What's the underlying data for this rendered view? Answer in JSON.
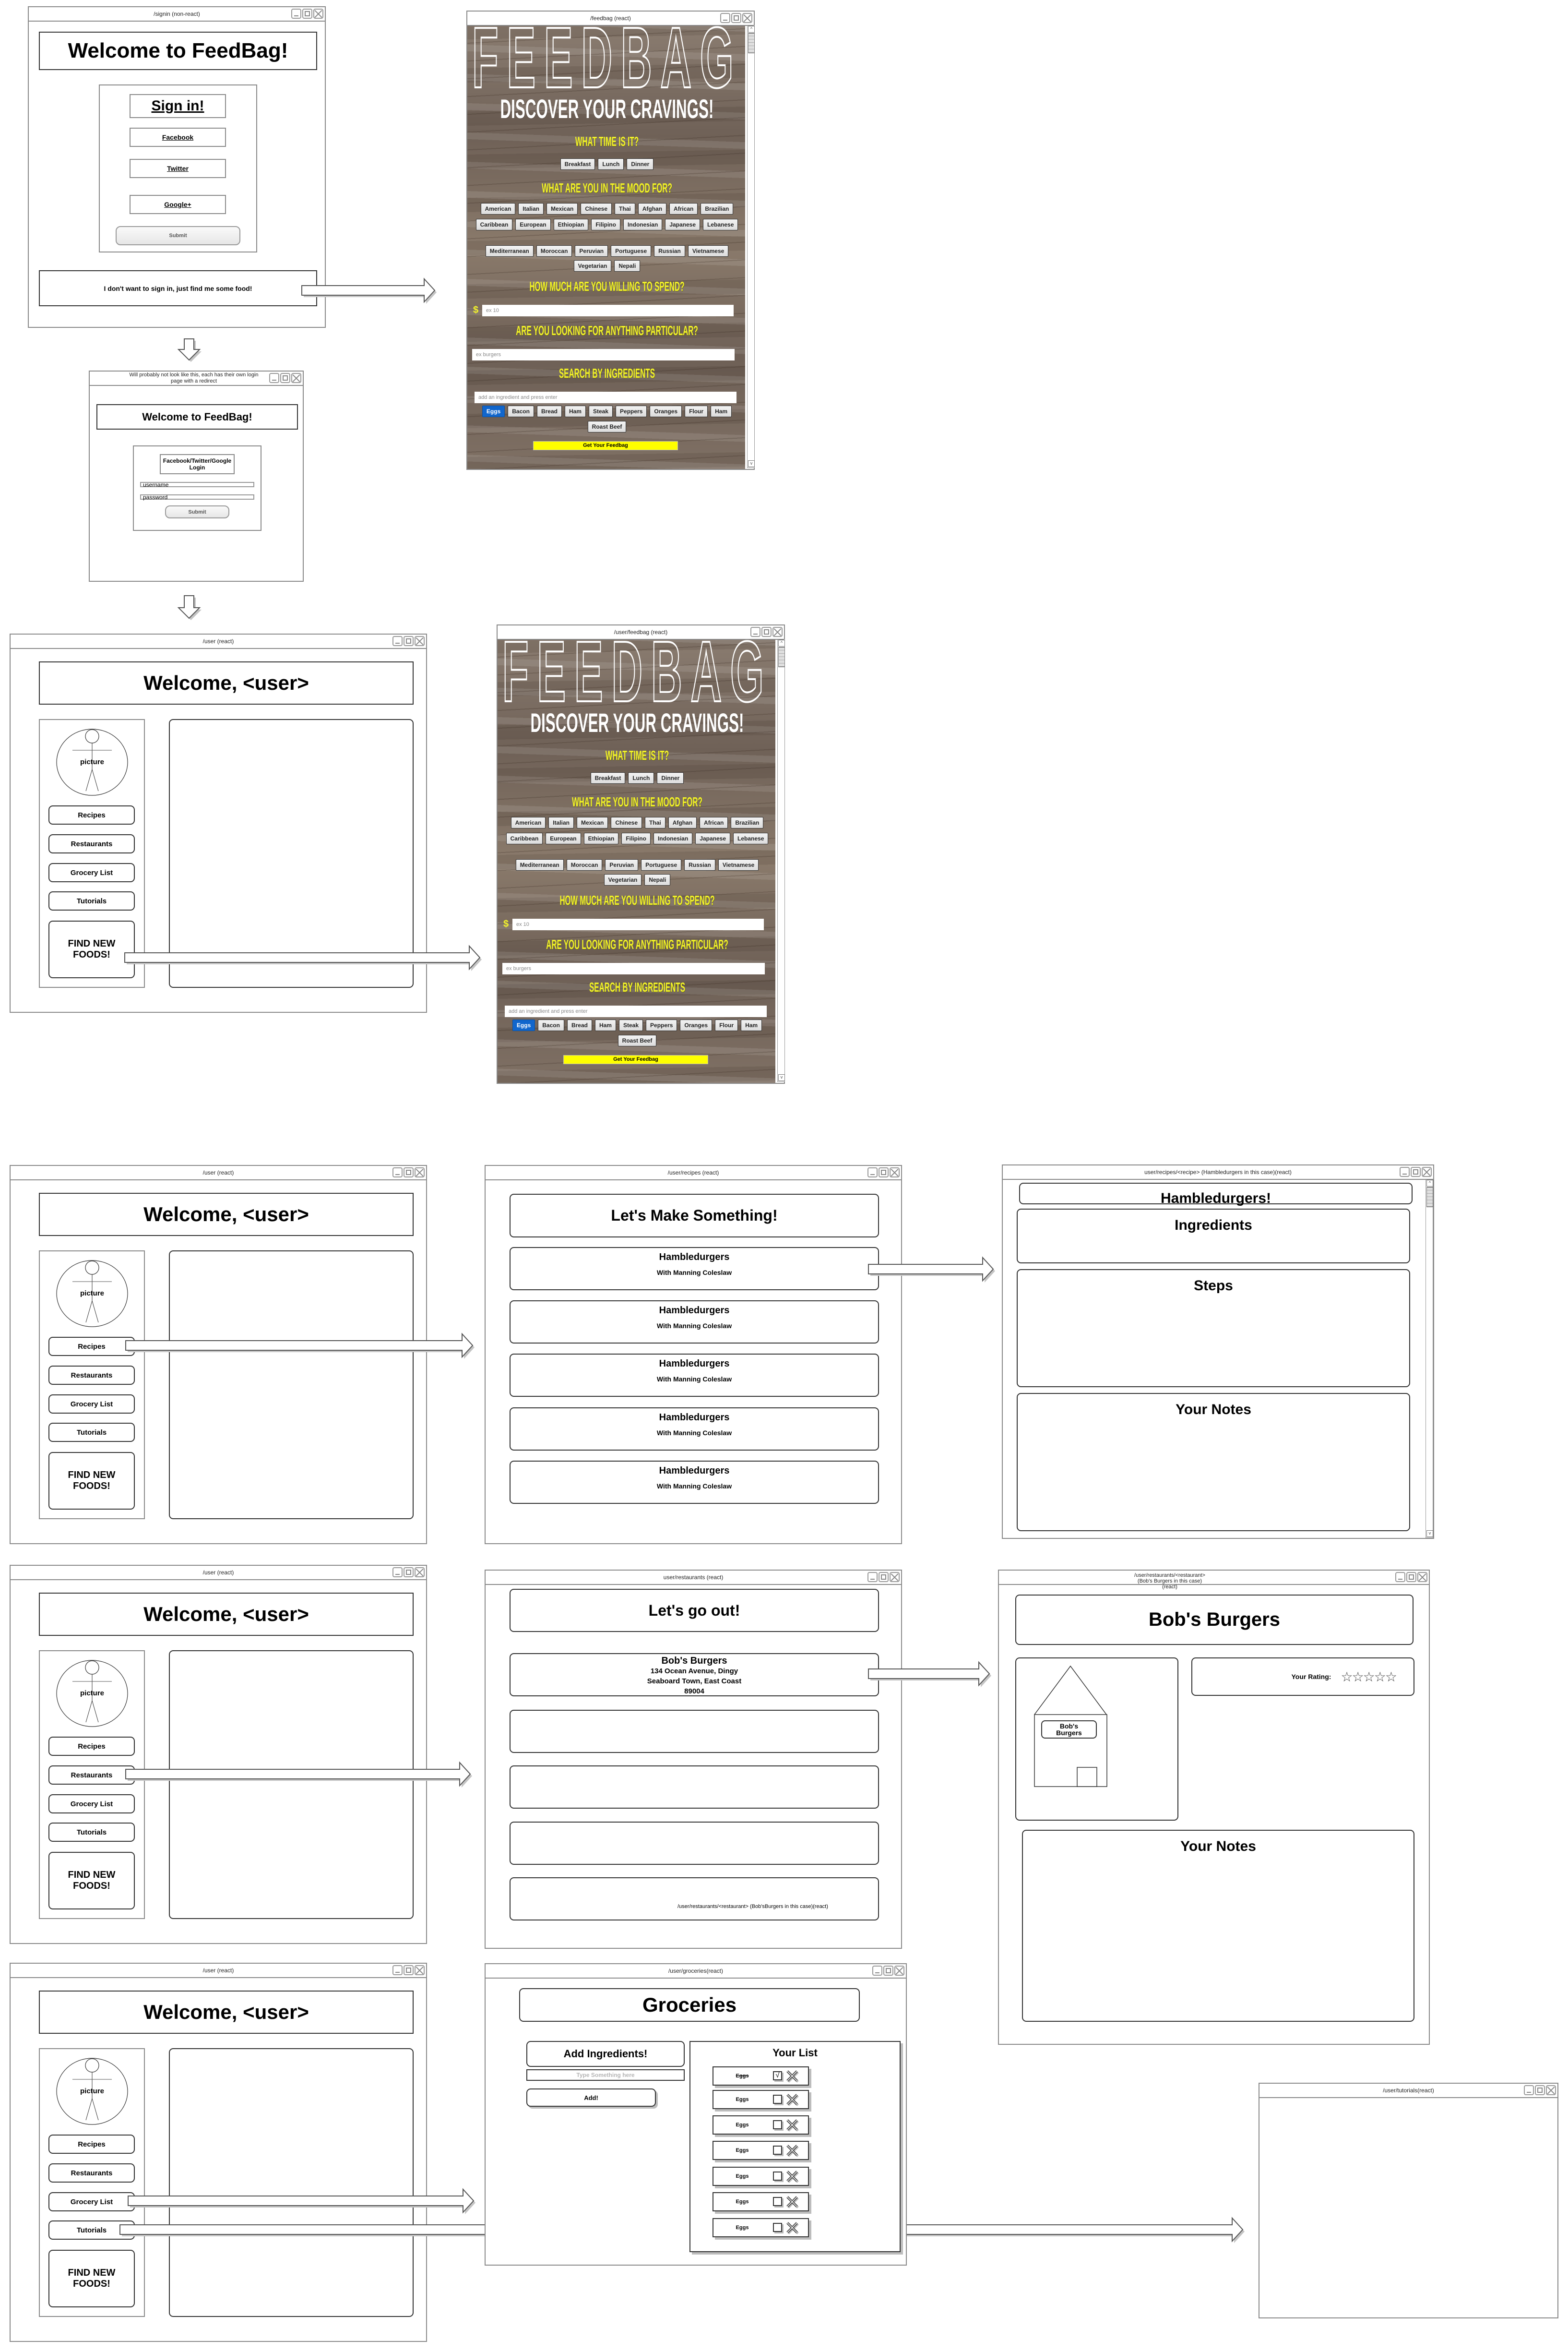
{
  "signin": {
    "title": "/signin (non-react)",
    "heading": "Welcome to FeedBag!",
    "sign_in": "Sign in!",
    "providers": [
      "Facebook",
      "Twitter",
      "Google+"
    ],
    "submit": "Submit",
    "guest": "I don't want to sign in, just find me some food!"
  },
  "redirect": {
    "title": "Will probably not look like this, each has their own login page with a redirect",
    "heading": "Welcome to FeedBag!",
    "login": "Facebook/Twitter/Google Login",
    "username": "username",
    "password": "password",
    "submit": "Submit"
  },
  "feedbag": {
    "titles": [
      "/feedbag (react)",
      "/user/feedbag (react)"
    ],
    "logo": "FEEDBAG",
    "tagline": "DISCOVER YOUR CRAVINGS!",
    "time_question": "WHAT TIME IS IT?",
    "times": [
      "Breakfast",
      "Lunch",
      "Dinner"
    ],
    "mood_question": "WHAT ARE YOU IN THE MOOD FOR?",
    "cuisines": [
      [
        "American",
        "Italian",
        "Mexican",
        "Chinese",
        "Thai",
        "Afghan",
        "African",
        "Brazilian"
      ],
      [
        "Caribbean",
        "European",
        "Ethiopian",
        "Filipino",
        "Indonesian",
        "Japanese",
        "Lebanese"
      ],
      [
        "Mediterranean",
        "Moroccan",
        "Peruvian",
        "Portuguese",
        "Russian",
        "Vietnamese"
      ],
      [
        "Vegetarian",
        "Nepali"
      ]
    ],
    "spend_question": "HOW MUCH ARE YOU WILLING TO SPEND?",
    "currency": "$",
    "spend_placeholder": "ex 10",
    "particular_question": "ARE YOU LOOKING FOR ANYTHING PARTICULAR?",
    "particular_placeholder": "ex burgers",
    "ingredients_question": "SEARCH BY INGREDIENTS",
    "ingredient_placeholder": "add an ingredient and press enter",
    "ingredients": [
      [
        {
          "label": "Eggs",
          "selected": true
        },
        {
          "label": "Bacon",
          "selected": false
        },
        {
          "label": "Bread",
          "selected": false
        },
        {
          "label": "Ham",
          "selected": false
        },
        {
          "label": "Steak",
          "selected": false
        },
        {
          "label": "Peppers",
          "selected": false
        },
        {
          "label": "Oranges",
          "selected": false
        },
        {
          "label": "Flour",
          "selected": false
        },
        {
          "label": "Ham",
          "selected": false
        }
      ],
      [
        {
          "label": "Roast Beef",
          "selected": false
        }
      ]
    ],
    "submit": "Get Your Feedbag",
    "colors": {
      "heading": "#f2f22a",
      "selected": "#1166cc",
      "submit": "#ffff00"
    }
  },
  "user": {
    "title": "/user (react)",
    "welcome": "Welcome, <user>",
    "picture": "picture",
    "nav": [
      "Recipes",
      "Restaurants",
      "Grocery List",
      "Tutorials"
    ],
    "find": "FIND NEW FOODS!"
  },
  "recipes": {
    "title": "/user/recipes (react)",
    "heading": "Let's Make Something!",
    "items": [
      {
        "name": "Hambledurgers",
        "subtitle": "With Manning Coleslaw"
      },
      {
        "name": "Hambledurgers",
        "subtitle": "With Manning Coleslaw"
      },
      {
        "name": "Hambledurgers",
        "subtitle": "With Manning Coleslaw"
      },
      {
        "name": "Hambledurgers",
        "subtitle": "With Manning Coleslaw"
      },
      {
        "name": "Hambledurgers",
        "subtitle": "With Manning Coleslaw"
      }
    ]
  },
  "recipe_detail": {
    "title": "user/recipes/<recipe> (Hambledurgers in this case)(react)",
    "heading": "Hambledurgers!",
    "sections": [
      "Ingredients",
      "Steps",
      "Your Notes"
    ]
  },
  "restaurants": {
    "title": "user/restaurants (react)",
    "heading": "Let's go out!",
    "items": [
      {
        "name": "Bob's Burgers",
        "address": [
          "134 Ocean Avenue, Dingy",
          "Seaboard Town, East Coast",
          "89004"
        ]
      }
    ],
    "note": "/user/restaurants/<restaurant> (Bob'sBurgers in this case)(react)"
  },
  "restaurant_detail": {
    "title": "/user/restaurants/<restaurant>(Bob's Burgers in this case) (react)",
    "heading": "Bob's Burgers",
    "sign": "Bob's Burgers",
    "rating_label": "Your Rating:",
    "rating": 0,
    "rating_max": 5,
    "notes": "Your Notes"
  },
  "groceries": {
    "title": "/user/groceries(react)",
    "heading": "Groceries",
    "add_heading": "Add Ingredients!",
    "input_placeholder": "Type Something here",
    "add_button": "Add!",
    "list_heading": "Your List",
    "items": [
      {
        "label": "Eggs",
        "checked": true
      },
      {
        "label": "Eggs",
        "checked": false
      },
      {
        "label": "Eggs",
        "checked": false
      },
      {
        "label": "Eggs",
        "checked": false
      },
      {
        "label": "Eggs",
        "checked": false
      },
      {
        "label": "Eggs",
        "checked": false
      },
      {
        "label": "Eggs",
        "checked": false
      }
    ]
  },
  "tutorials": {
    "title": "/user/tutorials(react)"
  }
}
